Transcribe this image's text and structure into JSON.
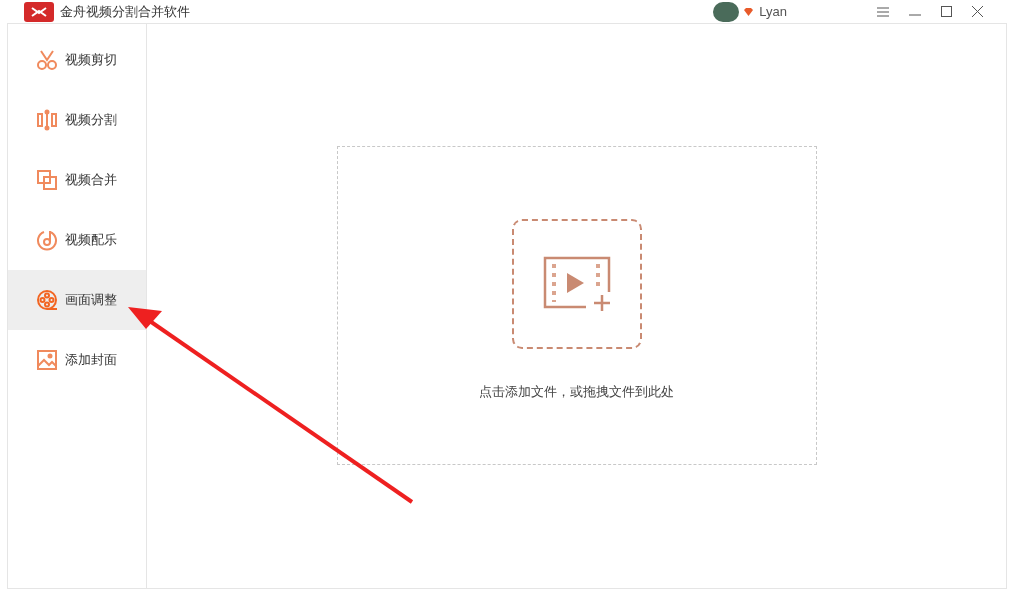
{
  "window": {
    "title": "金舟视频分割合并软件",
    "user": "Lyan"
  },
  "sidebar": {
    "items": [
      {
        "kind": "cut",
        "label": "视频剪切",
        "selected": false
      },
      {
        "kind": "split",
        "label": "视频分割",
        "selected": false
      },
      {
        "kind": "merge",
        "label": "视频合并",
        "selected": false
      },
      {
        "kind": "music",
        "label": "视频配乐",
        "selected": false
      },
      {
        "kind": "adjust",
        "label": "画面调整",
        "selected": true
      },
      {
        "kind": "cover",
        "label": "添加封面",
        "selected": false
      }
    ]
  },
  "drop_zone": {
    "hint": "点击添加文件，或拖拽文件到此处"
  }
}
